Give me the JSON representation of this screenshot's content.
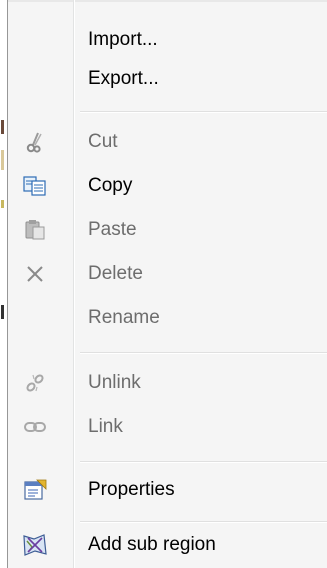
{
  "menu": {
    "items": [
      {
        "id": "import",
        "label": "Import...",
        "disabled": false,
        "icon": null
      },
      {
        "id": "export",
        "label": "Export...",
        "disabled": false,
        "icon": null
      },
      {
        "id": "cut",
        "label": "Cut",
        "disabled": true,
        "icon": "scissors-icon"
      },
      {
        "id": "copy",
        "label": "Copy",
        "disabled": false,
        "icon": "copy-icon"
      },
      {
        "id": "paste",
        "label": "Paste",
        "disabled": true,
        "icon": "paste-icon"
      },
      {
        "id": "delete",
        "label": "Delete",
        "disabled": true,
        "icon": "delete-x-icon"
      },
      {
        "id": "rename",
        "label": "Rename",
        "disabled": true,
        "icon": null
      },
      {
        "id": "unlink",
        "label": "Unlink",
        "disabled": true,
        "icon": "unlink-icon"
      },
      {
        "id": "link",
        "label": "Link",
        "disabled": true,
        "icon": "link-icon"
      },
      {
        "id": "properties",
        "label": "Properties",
        "disabled": false,
        "icon": "properties-icon"
      },
      {
        "id": "add_sub_region",
        "label": "Add sub region",
        "disabled": false,
        "icon": "add-sub-region-icon"
      }
    ]
  },
  "colors": {
    "menu_bg": "#f5f5f5",
    "enabled_text": "#000000",
    "disabled_text": "#6d6d6d",
    "separator": "#e0e0e0"
  }
}
